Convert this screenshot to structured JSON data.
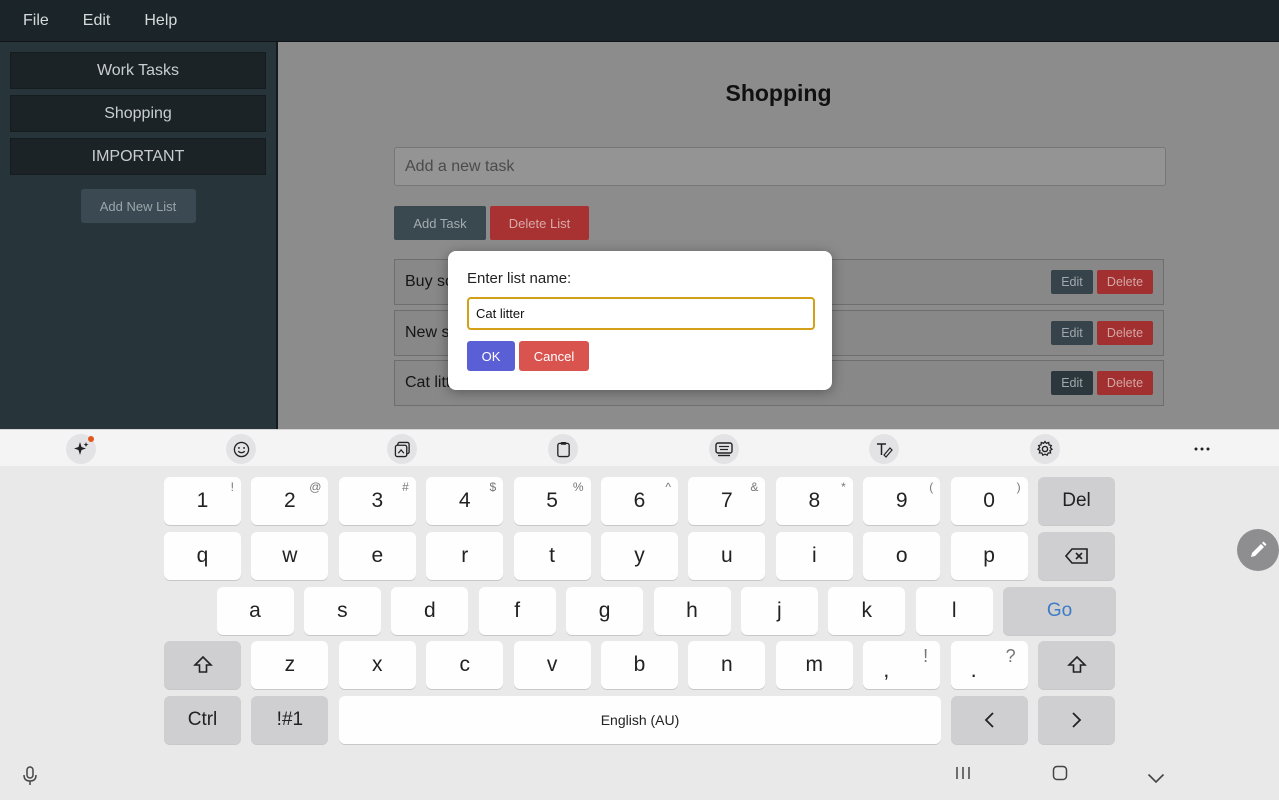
{
  "menu": {
    "items": [
      "File",
      "Edit",
      "Help"
    ]
  },
  "sidebar": {
    "lists": [
      "Work Tasks",
      "Shopping",
      "IMPORTANT"
    ],
    "add_button": "Add New List"
  },
  "main": {
    "title": "Shopping",
    "task_input_placeholder": "Add a new task",
    "add_task_label": "Add Task",
    "delete_list_label": "Delete List",
    "tasks": [
      {
        "text": "Buy so",
        "edit": "Edit",
        "delete": "Delete"
      },
      {
        "text": "New s",
        "edit": "Edit",
        "delete": "Delete"
      },
      {
        "text": "Cat litt",
        "edit": "Edit",
        "delete": "Delete"
      }
    ]
  },
  "dialog": {
    "label": "Enter list name:",
    "input_value": "Cat litter",
    "ok_label": "OK",
    "cancel_label": "Cancel"
  },
  "keyboard": {
    "toolbar_icons": [
      "ai-sparkle-icon",
      "emoji-icon",
      "sticker-icon",
      "clipboard-icon",
      "keyboard-mode-icon",
      "handwriting-icon",
      "settings-icon",
      "more-icon"
    ],
    "row1": [
      {
        "k": "1",
        "s": "!"
      },
      {
        "k": "2",
        "s": "@"
      },
      {
        "k": "3",
        "s": "#"
      },
      {
        "k": "4",
        "s": "$"
      },
      {
        "k": "5",
        "s": "%"
      },
      {
        "k": "6",
        "s": "^"
      },
      {
        "k": "7",
        "s": "&"
      },
      {
        "k": "8",
        "s": "*"
      },
      {
        "k": "9",
        "s": "("
      },
      {
        "k": "0",
        "s": ")"
      }
    ],
    "del_label": "Del",
    "row2": [
      "q",
      "w",
      "e",
      "r",
      "t",
      "y",
      "u",
      "i",
      "o",
      "p"
    ],
    "row3": [
      "a",
      "s",
      "d",
      "f",
      "g",
      "h",
      "j",
      "k",
      "l"
    ],
    "go_label": "Go",
    "row4": [
      "z",
      "x",
      "c",
      "v",
      "b",
      "n",
      "m"
    ],
    "comma": {
      "k": ",",
      "s": "!"
    },
    "period": {
      "k": ".",
      "s": "?"
    },
    "ctrl_label": "Ctrl",
    "symbols_label": "!#1",
    "space_label": "English (AU)",
    "left_label": "<",
    "right_label": ">"
  },
  "navbar": {
    "recents": "|||",
    "home": "▢",
    "back": "⌵"
  }
}
